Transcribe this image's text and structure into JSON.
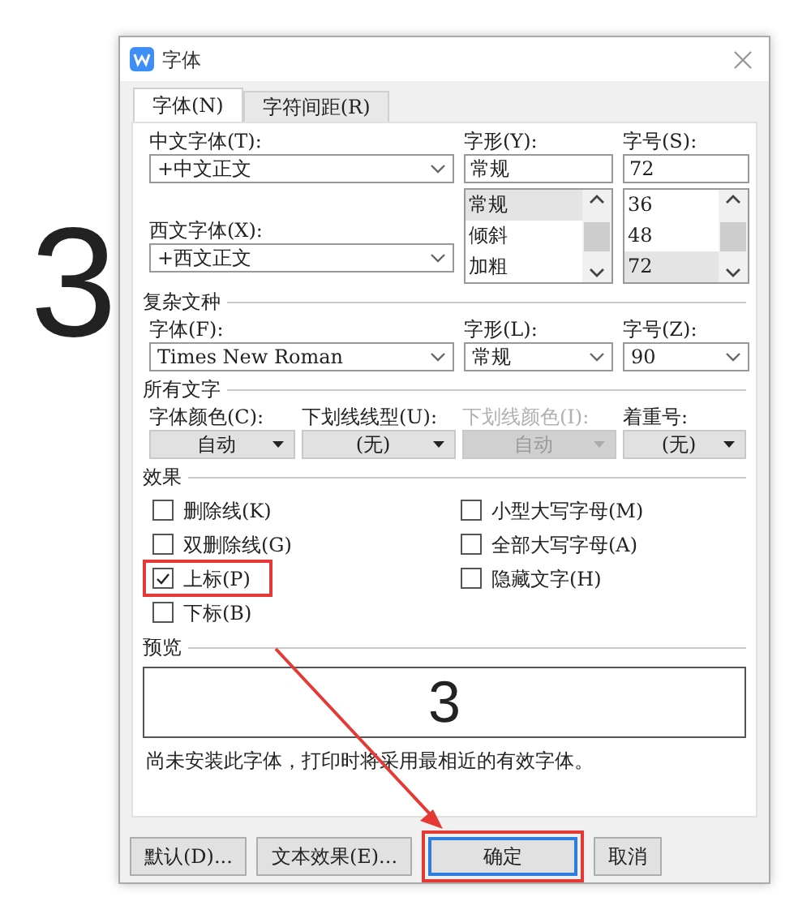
{
  "background_text": "3",
  "window": {
    "title": "字体"
  },
  "tabs": [
    {
      "label": "字体(N)",
      "selected": true
    },
    {
      "label": "字符间距(R)",
      "selected": false
    }
  ],
  "chinese_font": {
    "label": "中文字体(T):",
    "value": "+中文正文"
  },
  "western_font": {
    "label": "西文字体(X):",
    "value": "+西文正文"
  },
  "style": {
    "label": "字形(Y):",
    "value": "常规",
    "options": [
      {
        "label": "常规",
        "selected": true
      },
      {
        "label": "倾斜",
        "selected": false
      },
      {
        "label": "加粗",
        "selected": false
      }
    ]
  },
  "size": {
    "label": "字号(S):",
    "value": "72",
    "options": [
      {
        "label": "36",
        "selected": false
      },
      {
        "label": "48",
        "selected": false
      },
      {
        "label": "72",
        "selected": true
      }
    ]
  },
  "complex_script": {
    "heading": "复杂文种",
    "fields": [
      {
        "label": "字体(F):",
        "value": "Times New Roman"
      },
      {
        "label": "字形(L):",
        "value": "常规"
      },
      {
        "label": "字号(Z):",
        "value": "90"
      }
    ]
  },
  "all_text": {
    "heading": "所有文字",
    "fields": [
      {
        "label": "字体颜色(C):",
        "value": "自动",
        "disabled": false
      },
      {
        "label": "下划线线型(U):",
        "value": "(无)",
        "disabled": false
      },
      {
        "label": "下划线颜色(I):",
        "value": "自动",
        "disabled": true
      },
      {
        "label": "着重号:",
        "value": "(无)",
        "disabled": false
      }
    ]
  },
  "effects": {
    "heading": "效果",
    "options": [
      {
        "label": "删除线(K)",
        "checked": false,
        "highlighted": false
      },
      {
        "label": "小型大写字母(M)",
        "checked": false,
        "highlighted": false
      },
      {
        "label": "双删除线(G)",
        "checked": false,
        "highlighted": false
      },
      {
        "label": "全部大写字母(A)",
        "checked": false,
        "highlighted": false
      },
      {
        "label": "上标(P)",
        "checked": true,
        "highlighted": true
      },
      {
        "label": "隐藏文字(H)",
        "checked": false,
        "highlighted": false
      },
      {
        "label": "下标(B)",
        "checked": false,
        "highlighted": false
      }
    ]
  },
  "preview": {
    "heading": "预览",
    "text": "3",
    "note": "尚未安装此字体，打印时将采用最相近的有效字体。"
  },
  "buttons": [
    {
      "label": "默认(D)...",
      "focused": false,
      "highlighted": false
    },
    {
      "label": "文本效果(E)...",
      "focused": false,
      "highlighted": false
    },
    {
      "label": "确定",
      "focused": true,
      "highlighted": true
    },
    {
      "label": "取消",
      "focused": false,
      "highlighted": false
    }
  ]
}
